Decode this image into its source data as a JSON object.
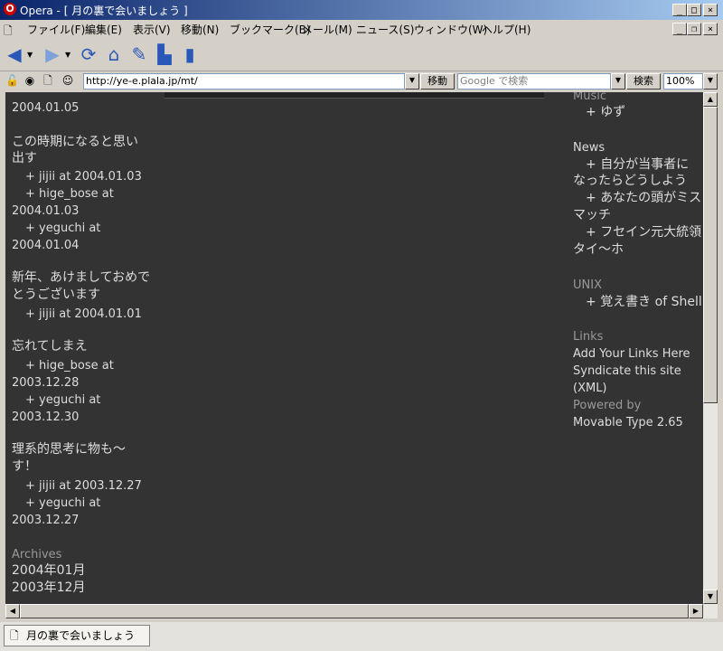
{
  "window": {
    "title": "Opera - [ 月の裏で会いましょう ]",
    "logo_letter": "O"
  },
  "menu": [
    "ファイル(F)",
    "編集(E)",
    "表示(V)",
    "移動(N)",
    "ブックマーク(B)",
    "メール(M)",
    "ニュース(S)",
    "ウィンドウ(W)",
    "ヘルプ(H)"
  ],
  "address": {
    "url": "http://ye-e.plala.jp/mt/",
    "go_label": "移動",
    "search_placeholder": "Google で検索",
    "search_label": "検索",
    "zoom": "100%"
  },
  "left_column": {
    "top_date": "2004.01.05",
    "posts": [
      {
        "title": [
          "この時期になると思い",
          "出す"
        ],
        "comments": [
          [
            "jijii  at 2004.01.03"
          ],
          [
            "hige_bose  at",
            "2004.01.03"
          ],
          [
            "yeguchi  at",
            "2004.01.04"
          ]
        ]
      },
      {
        "title": [
          "新年、あけましておめで",
          "とうございます"
        ],
        "comments": [
          [
            "jijii  at 2004.01.01"
          ]
        ]
      },
      {
        "title": [
          "忘れてしまえ"
        ],
        "comments": [
          [
            "hige_bose  at",
            "2003.12.28"
          ],
          [
            "yeguchi  at",
            "2003.12.30"
          ]
        ]
      },
      {
        "title": [
          "理系的思考に物も〜",
          "す！"
        ],
        "comments": [
          [
            "jijii  at 2003.12.27"
          ],
          [
            "yeguchi  at",
            "2003.12.27"
          ]
        ]
      }
    ],
    "archives_heading": "Archives",
    "archives": [
      "2004年01月",
      "2003年12月"
    ]
  },
  "right_column": {
    "music_heading": "Music",
    "music_items": [
      "ゆず"
    ],
    "news_heading": "News",
    "news_items": [
      [
        "自分が当事者に",
        "なったらどうしよう"
      ],
      [
        "あなたの頭がミス",
        "マッチ"
      ],
      [
        "フセイン元大統領",
        "タイ〜ホ"
      ]
    ],
    "unix_heading": "UNIX",
    "unix_items": [
      "覚え書き of Shell"
    ],
    "links_heading": "Links",
    "links": [
      "Add Your Links Here",
      "Syndicate this site",
      "(XML)"
    ],
    "powered_label": "Powered by",
    "powered_link": "Movable Type 2.65"
  },
  "status": {
    "tab_title": "月の裏で会いましょう"
  }
}
